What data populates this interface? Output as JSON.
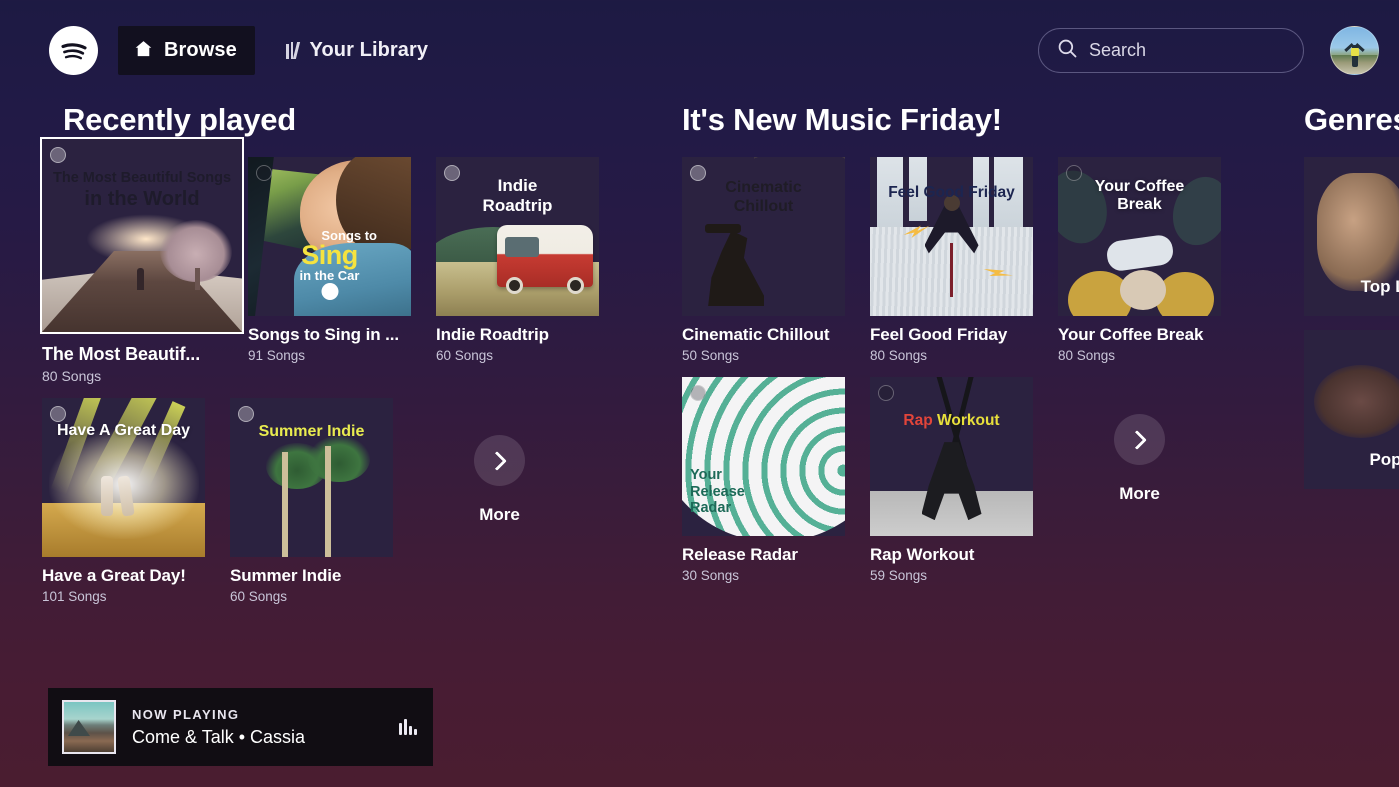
{
  "topbar": {
    "logo_icon": "spotify-logo-icon",
    "browse": {
      "label": "Browse",
      "icon": "home-icon",
      "active": true
    },
    "library": {
      "label": "Your Library",
      "icon": "library-bars-icon"
    },
    "search": {
      "placeholder": "Search",
      "icon": "search-icon"
    },
    "avatar_alt": "user-avatar"
  },
  "sections": [
    {
      "id": "recently-played",
      "title": "Recently played",
      "more_label": "More",
      "tiles": [
        {
          "name": "The Most Beautif...",
          "full_name": "The Most Beautiful Songs in the World",
          "songs": "80 Songs",
          "focused": true,
          "art": {
            "key": "art-beautiful",
            "l1": "The Most Beautiful Songs",
            "l2": "in the World"
          }
        },
        {
          "name": "Songs to Sing in ...",
          "full_name": "Songs to Sing in the Car",
          "songs": "91 Songs",
          "focused": false,
          "art": {
            "key": "art-sing",
            "l1": "Songs to",
            "l2": "Sing",
            "l3": "in the Car"
          }
        },
        {
          "name": "Indie Roadtrip",
          "songs": "60 Songs",
          "focused": false,
          "art": {
            "key": "art-indie",
            "l1": "Indie",
            "l2": "Roadtrip"
          }
        },
        {
          "name": "Have a Great Day!",
          "songs": "101 Songs",
          "focused": false,
          "art": {
            "key": "art-day",
            "l1": "Have A Great Day"
          }
        },
        {
          "name": "Summer Indie",
          "songs": "60 Songs",
          "focused": false,
          "art": {
            "key": "art-summer",
            "l1": "Summer Indie"
          }
        }
      ]
    },
    {
      "id": "new-music-friday",
      "title": "It's New Music Friday!",
      "more_label": "More",
      "tiles": [
        {
          "name": "Cinematic Chillout",
          "songs": "50 Songs",
          "focused": false,
          "art": {
            "key": "art-cine",
            "l1": "Cinematic",
            "l2": "Chillout"
          }
        },
        {
          "name": "Feel Good Friday",
          "songs": "80 Songs",
          "focused": false,
          "art": {
            "key": "art-feel",
            "l1": "Feel Good Friday"
          }
        },
        {
          "name": "Your Coffee Break",
          "songs": "80 Songs",
          "focused": false,
          "art": {
            "key": "art-coffee",
            "l1": "Your Coffee",
            "l2": "Break"
          }
        },
        {
          "name": "Release Radar",
          "songs": "30 Songs",
          "focused": false,
          "art": {
            "key": "art-radar",
            "l1": "Your",
            "l2": "Release",
            "l3": "Radar"
          }
        },
        {
          "name": "Rap Workout",
          "songs": "59 Songs",
          "focused": false,
          "art": {
            "key": "art-rap",
            "l1a": "Rap ",
            "l1b": "Workout"
          }
        }
      ]
    },
    {
      "id": "genres",
      "title": "Genres",
      "clipped": true,
      "tiles": [
        {
          "art": {
            "key": "art-top",
            "l1": "Top Li"
          }
        },
        {
          "art": {
            "key": "art-pop",
            "l1": "Pop"
          }
        }
      ]
    }
  ],
  "now_playing": {
    "label": "NOW PLAYING",
    "track": "Come & Talk • Cassia",
    "eq_icon": "equalizer-icon",
    "thumb_alt": "album-thumbnail"
  },
  "colors": {
    "bg_top": "#1d1a43",
    "bg_bottom": "#4a1d30",
    "browse_bg": "#12101f",
    "now_playing_bg": "#110d13",
    "text_primary": "#ffffff",
    "text_secondary": "#c9c5d8"
  }
}
